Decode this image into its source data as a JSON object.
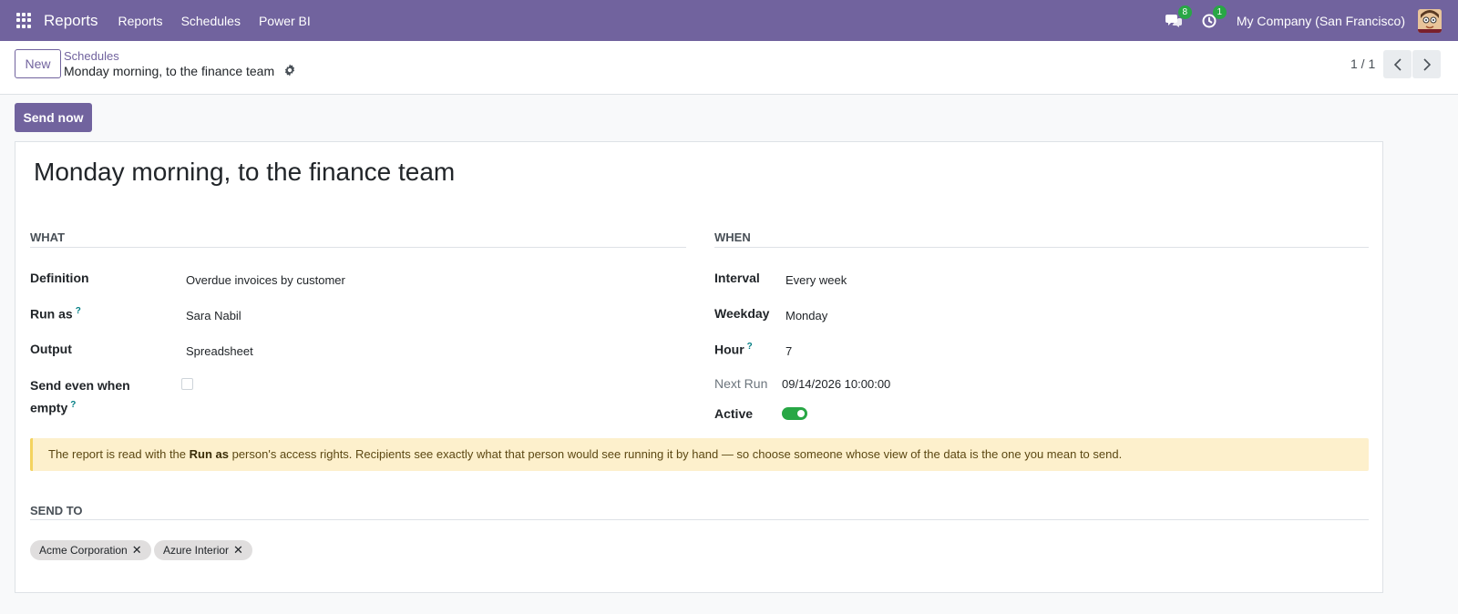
{
  "navbar": {
    "app_name": "Reports",
    "menu": [
      "Reports",
      "Schedules",
      "Power BI"
    ],
    "messages_count": "8",
    "activities_count": "1",
    "company": "My Company (San Francisco)"
  },
  "control_panel": {
    "new_label": "New",
    "breadcrumb_parent": "Schedules",
    "breadcrumb_current": "Monday morning, to the finance team",
    "pager_value": "1 / 1"
  },
  "actions": {
    "send_now": "Send now"
  },
  "form": {
    "title": "Monday morning, to the finance team",
    "what": {
      "heading": "WHAT",
      "definition_label": "Definition",
      "definition_value": "Overdue invoices by customer",
      "run_as_label": "Run as",
      "run_as_value": "Sara Nabil",
      "output_label": "Output",
      "output_value": "Spreadsheet",
      "send_empty_label_1": "Send even when",
      "send_empty_label_2": "empty",
      "send_empty_checked": false
    },
    "when": {
      "heading": "WHEN",
      "interval_label": "Interval",
      "interval_value": "Every week",
      "weekday_label": "Weekday",
      "weekday_value": "Monday",
      "hour_label": "Hour",
      "hour_value": "7",
      "next_run_label": "Next Run",
      "next_run_value": "09/14/2026 10:00:00",
      "active_label": "Active",
      "active": true
    },
    "help_mark": "?",
    "alert": {
      "before": "The report is read with the ",
      "bold": "Run as",
      "after": " person's access rights. Recipients see exactly what that person would see running it by hand — so choose someone whose view of the data is the one you mean to send."
    },
    "send_to": {
      "heading": "SEND TO",
      "recipients": [
        "Acme Corporation",
        "Azure Interior"
      ]
    }
  },
  "colors": {
    "brand": "#71639e",
    "success": "#28a745",
    "alert_bg": "#fdf0cc"
  }
}
